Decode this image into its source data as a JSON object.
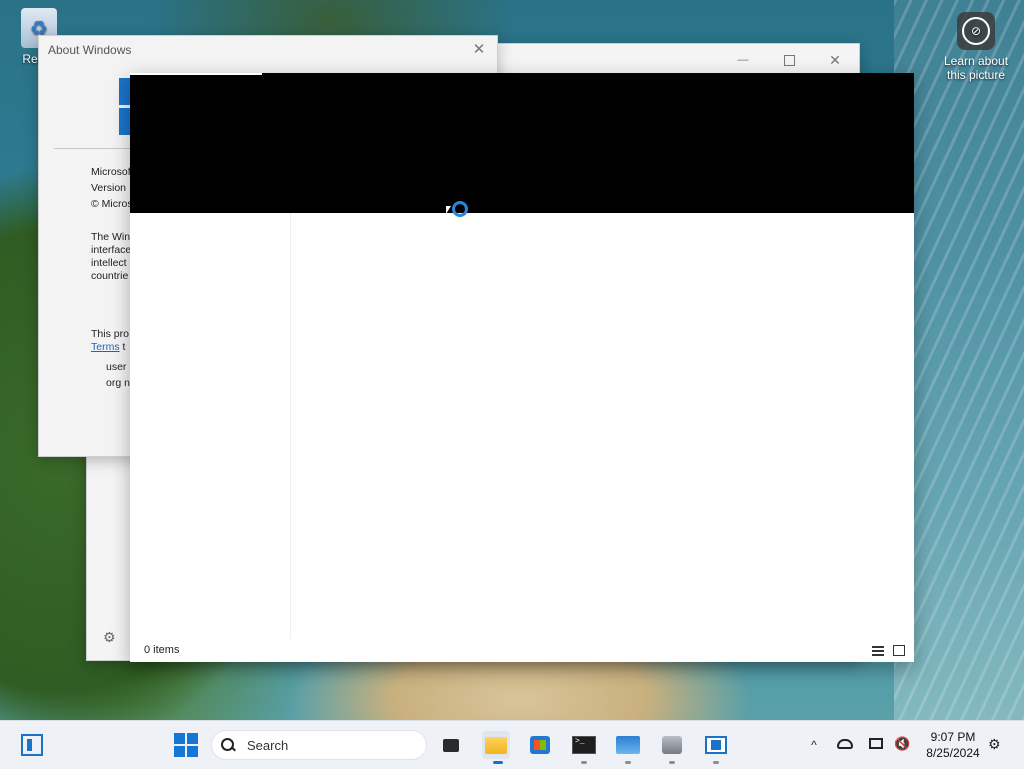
{
  "desktop": {
    "recycle_bin_label": "Recyc",
    "learn_label": "Learn about this picture"
  },
  "about_dialog": {
    "title": "About Windows",
    "close_glyph": "✕",
    "line1": "Microsof",
    "line2": "Version",
    "line3": "© Micros",
    "para1_l1": "The Win",
    "para1_l2": "interface",
    "para1_l3": "intellect",
    "para1_l4": "countrie",
    "license_text": "This pro",
    "terms_link": "Terms",
    "terms_suffix": " t",
    "user_label": "user",
    "org_label": "org n"
  },
  "explorer_back": {
    "minimize_glyph": "—",
    "close_glyph": "✕",
    "settings_glyph": "⚙"
  },
  "front_window": {
    "status_text": "0 items"
  },
  "taskbar": {
    "search_placeholder": "Search",
    "tray_chevron": "^",
    "volume_glyph": "🔇",
    "time": "9:07 PM",
    "date": "8/25/2024",
    "notification_glyph": "⚙",
    "terminal_glyph": ">_"
  },
  "colors": {
    "accent": "#1a73c9",
    "taskbar_bg": "#eef1f6"
  }
}
